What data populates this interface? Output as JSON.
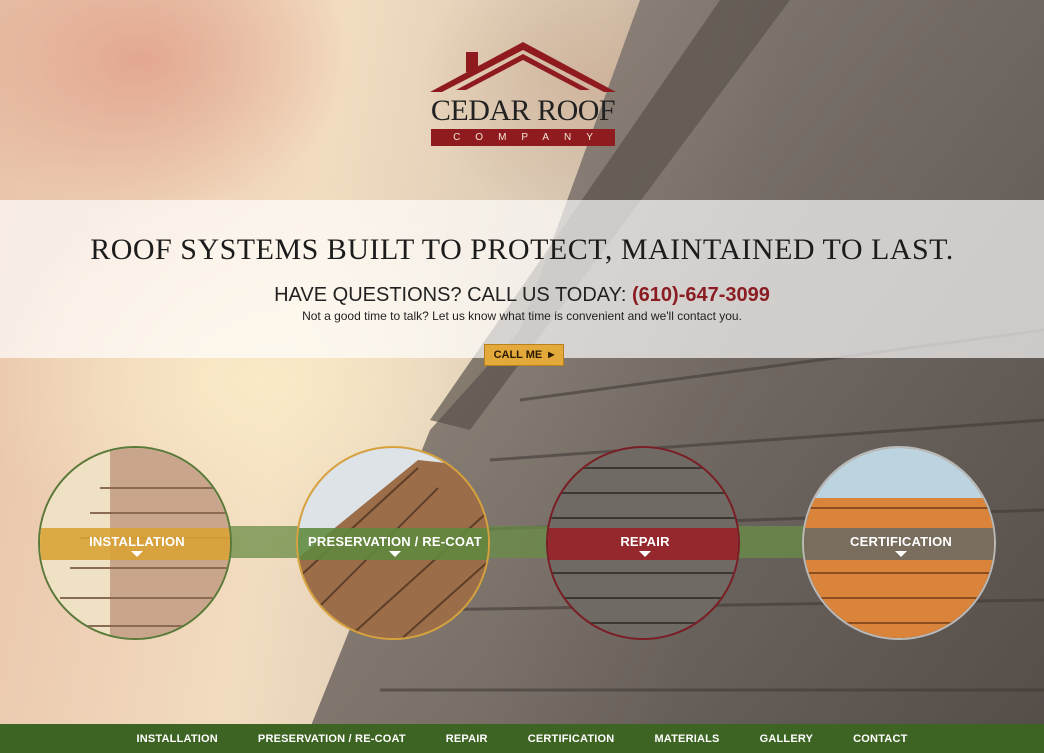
{
  "brand": {
    "name": "CEDAR ROOF",
    "sub": "COMPANY",
    "colors": {
      "red": "#8f1b1f",
      "green": "#3e6424",
      "gold": "#e3a93a"
    }
  },
  "hero": {
    "headline": "ROOF SYSTEMS BUILT TO PROTECT, MAINTAINED TO LAST.",
    "question": "HAVE QUESTIONS? CALL US TODAY:",
    "phone": "(610)-647-3099",
    "subtext": "Not a good time to talk? Let us know what time is convenient and we'll contact you.",
    "cta": "CALL ME",
    "cta_icon": "caret-right-icon"
  },
  "services": [
    {
      "label": "INSTALLATION",
      "color": "#d9a233"
    },
    {
      "label": "PRESERVATION / RE-COAT",
      "color": "#5f8a3e"
    },
    {
      "label": "REPAIR",
      "color": "#9a1f26"
    },
    {
      "label": "CERTIFICATION",
      "color": "#6b6b63"
    }
  ],
  "nav": {
    "items": [
      "INSTALLATION",
      "PRESERVATION / RE-COAT",
      "REPAIR",
      "CERTIFICATION",
      "MATERIALS",
      "GALLERY",
      "CONTACT"
    ]
  }
}
